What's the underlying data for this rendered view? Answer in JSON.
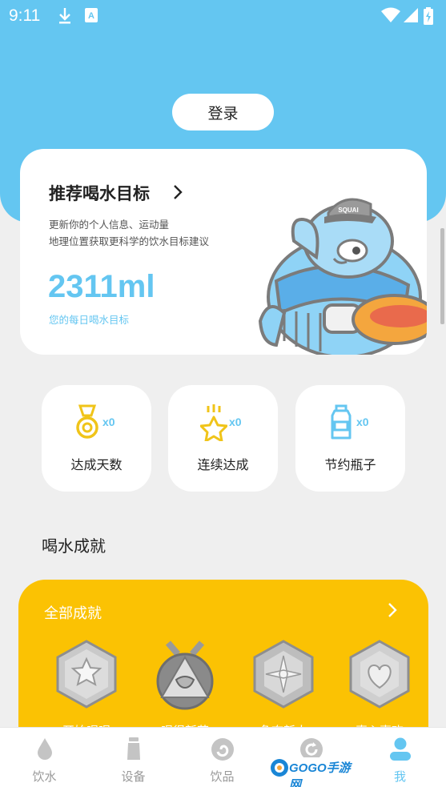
{
  "status_bar": {
    "time": "9:11",
    "icons": [
      "download-icon",
      "a-badge-icon",
      "wifi-icon",
      "signal-icon",
      "battery-icon"
    ]
  },
  "login": {
    "label": "登录"
  },
  "target": {
    "title": "推荐喝水目标",
    "desc_line1": "更新你的个人信息、运动量",
    "desc_line2": "地理位置获取更科学的饮水目标建议",
    "value": "2311ml",
    "value_label": "您的每日喝水目标",
    "mascot_cap_text": "SQUAI"
  },
  "stats": [
    {
      "icon": "medal-icon",
      "count": "x0",
      "label": "达成天数"
    },
    {
      "icon": "star-trophy-icon",
      "count": "x0",
      "label": "连续达成"
    },
    {
      "icon": "bottle-icon",
      "count": "x0",
      "label": "节约瓶子"
    }
  ],
  "section": {
    "title": "喝水成就"
  },
  "achievements": {
    "title": "全部成就",
    "medals": [
      {
        "icon": "star-hex-badge-icon",
        "label": "开始喝喝"
      },
      {
        "icon": "mask-triangle-badge-icon",
        "label": "喝得新花"
      },
      {
        "icon": "compass-hex-badge-icon",
        "label": "争夺新人"
      },
      {
        "icon": "heart-hex-badge-icon",
        "label": "真心喜欢"
      }
    ]
  },
  "nav": [
    {
      "icon": "water-drop-icon",
      "label": "饮水"
    },
    {
      "icon": "cup-device-icon",
      "label": "设备"
    },
    {
      "icon": "drink-icon",
      "label": "饮品"
    },
    {
      "icon": "refresh-icon",
      "label": ""
    },
    {
      "icon": "person-icon",
      "label": "我"
    }
  ],
  "watermark": {
    "text": "GOGO手游网"
  },
  "colors": {
    "primary": "#64c6f1",
    "achievement": "#fbc203",
    "stat_icon": "#f0c419"
  }
}
